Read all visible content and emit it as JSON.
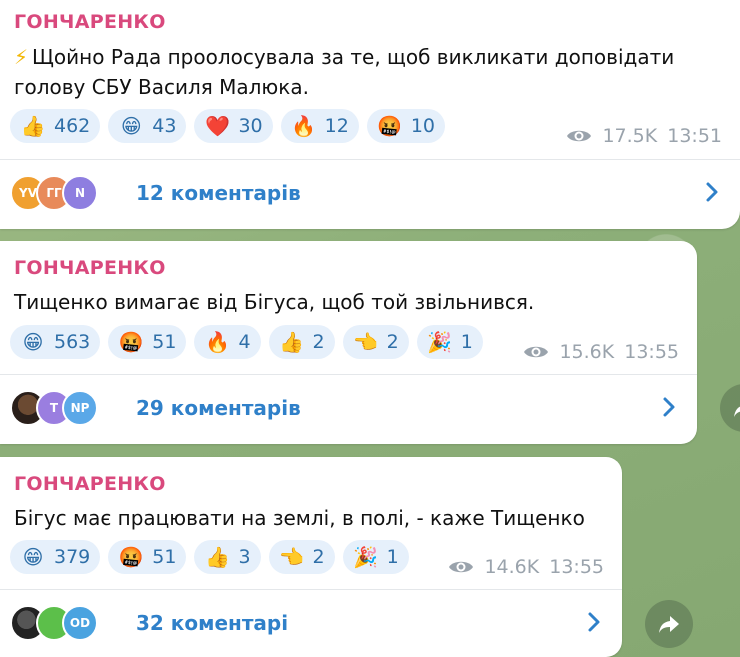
{
  "posts": [
    {
      "author": "ГОНЧАРЕНКО",
      "text_line1": "Щойно Рада проолосувала за те, щоб викликати доповідати",
      "text_line2": "голову СБУ Василя Малюка.",
      "reactions": [
        {
          "emoji": "👍",
          "count": "462"
        },
        {
          "emoji": "😁",
          "count": "43"
        },
        {
          "emoji": "❤️",
          "count": "30"
        },
        {
          "emoji": "🔥",
          "count": "12"
        },
        {
          "emoji": "🤬",
          "count": "10"
        }
      ],
      "views": "17.5K",
      "time": "13:51",
      "avatars": [
        "YV",
        "ГГ",
        "N"
      ],
      "comments": "12 коментарів"
    },
    {
      "author": "ГОНЧАРЕНКО",
      "text_line1": "Тищенко вимагає від Бігуса, щоб той звільнився.",
      "reactions": [
        {
          "emoji": "😁",
          "count": "563"
        },
        {
          "emoji": "🤬",
          "count": "51"
        },
        {
          "emoji": "🔥",
          "count": "4"
        },
        {
          "emoji": "👍",
          "count": "2"
        },
        {
          "emoji": "👈",
          "count": "2"
        },
        {
          "emoji": "🎉",
          "count": "1"
        }
      ],
      "views": "15.6K",
      "time": "13:55",
      "avatars": [
        "",
        "T",
        "NP"
      ],
      "comments": "29 коментарів"
    },
    {
      "author": "ГОНЧАРЕНКО",
      "text_line1": "Бігус має працювати на землі, в полі, - каже Тищенко",
      "reactions": [
        {
          "emoji": "😁",
          "count": "379"
        },
        {
          "emoji": "🤬",
          "count": "51"
        },
        {
          "emoji": "👍",
          "count": "3"
        },
        {
          "emoji": "👈",
          "count": "2"
        },
        {
          "emoji": "🎉",
          "count": "1"
        }
      ],
      "views": "14.6K",
      "time": "13:55",
      "avatars": [
        "",
        "",
        "OD"
      ],
      "comments": "32 коментарі"
    }
  ],
  "colors": {
    "author": "#d9497d",
    "link": "#2f80c9",
    "reaction_bg": "#e6f0fb",
    "meta": "#9aa3ac"
  }
}
